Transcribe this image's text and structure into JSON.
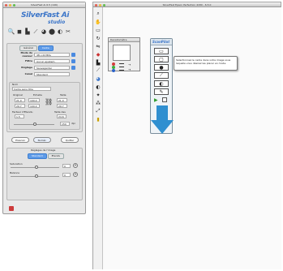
{
  "left_window": {
    "title": "SilverFast Ai 6.5 (149)",
    "logo_main": "SilverFast Ai",
    "logo_sub": "studio",
    "toolbar_icons": [
      "zoom-icon",
      "eyedropper-icon",
      "histogram-icon",
      "gradation-icon",
      "color-icon",
      "selective-color-icon",
      "sharpen-icon",
      "tools-icon"
    ],
    "tabs": [
      {
        "label": "Général"
      },
      {
        "label": "Cadre"
      }
    ],
    "fields": [
      {
        "label": "Mode de couleur",
        "value": "48->24 Bits"
      },
      {
        "label": "Filtre",
        "value": "Aucun ajustem."
      },
      {
        "label": "Réglage",
        "value": "Sauvegarder"
      },
      {
        "label": "Canal",
        "value": "Standard"
      }
    ],
    "name_label": "Nom",
    "name_value": "Cadre sans titre",
    "original_label": "Original",
    "echelle_label": "Echelle",
    "taille_label": "Taille",
    "orig_w": "21.0",
    "orig_h": "29.7",
    "scale_w": "100.0",
    "scale_h": "100.0",
    "out_w": "21.0",
    "out_h": "29.7",
    "format_label": "Facteur d'Etendu",
    "file_label": "Taille des",
    "format_val": "1.5",
    "file_val": "24.6",
    "res_label": "150",
    "res_unit": "dpi",
    "buttons": {
      "prescan": "Prescan",
      "scan": "Numér.",
      "quit": "Quitter"
    },
    "lower_group": "Réglages de l'image",
    "lower_tabs": [
      {
        "label": "Standard"
      },
      {
        "label": "Etendu"
      }
    ],
    "saturation_label": "Saturation",
    "saturation_val": "0",
    "balance_label": "Balance",
    "balance_val": "0"
  },
  "main_window": {
    "title": "SilverFast Epson Perfection 4180 - 6.5.0",
    "palette_title": "Densitomètre",
    "tooltip": "Sélectionnez le cadre dans votre image sous laquelle vous désirez les placer en mode.",
    "scanpilot_label": "ScanPilot",
    "sf_buttons": [
      "prescan-icon",
      "frame-icon",
      "auto-icon",
      "gradation-icon",
      "sharpen-icon",
      "scan-icon"
    ]
  },
  "colors": {
    "accent": "#3a74c8",
    "arrow": "#2f8fd0",
    "tab_sel": "#5e9be8"
  }
}
